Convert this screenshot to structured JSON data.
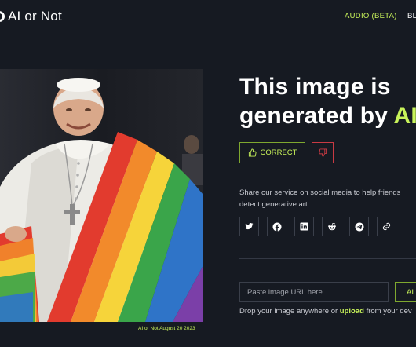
{
  "header": {
    "logo_text": "AI or Not",
    "nav": [
      {
        "label": "AUDIO (BETA)"
      },
      {
        "label": "BL"
      }
    ]
  },
  "image": {
    "caption": "AI or Not August 20 2023"
  },
  "result": {
    "headline_line1": "This image is",
    "headline_line2_prefix": "generated by ",
    "headline_line2_highlight": "AI",
    "correct_label": "CORRECT"
  },
  "share": {
    "text": "Share our service on social media to help friends detect generative art",
    "icons": [
      "twitter-icon",
      "facebook-icon",
      "linkedin-icon",
      "reddit-icon",
      "telegram-icon",
      "link-icon"
    ]
  },
  "upload": {
    "placeholder": "Paste image URL here",
    "button_label": "AI",
    "drop_prefix": "Drop your image anywhere or ",
    "drop_link": "upload",
    "drop_suffix": " from your dev"
  },
  "colors": {
    "background": "#161a22",
    "accent": "#c8f35a",
    "danger": "#c93a43"
  }
}
